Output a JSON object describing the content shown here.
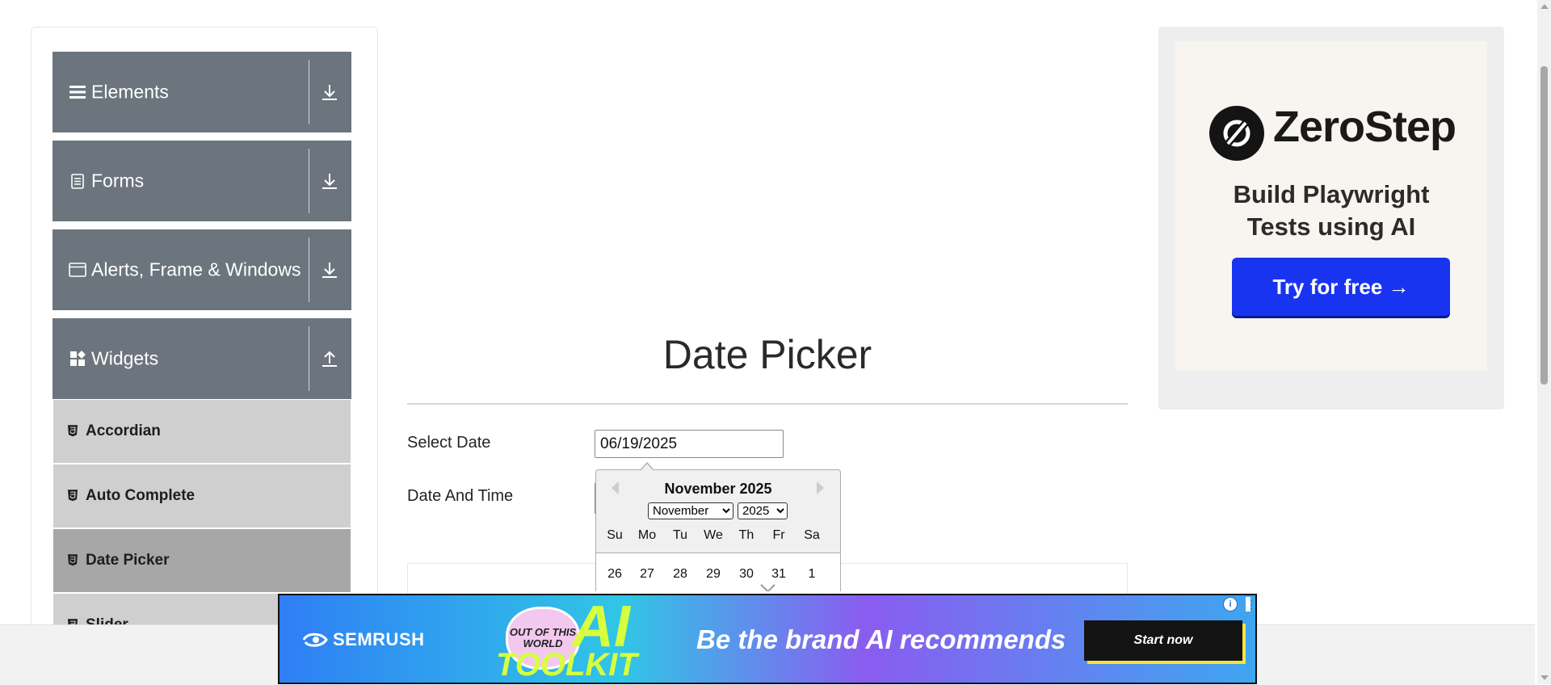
{
  "sidebar": {
    "groups": [
      {
        "label": "Elements",
        "icon": "bars-icon",
        "arrow": "download-arrow-icon"
      },
      {
        "label": "Forms",
        "icon": "document-icon",
        "arrow": "download-arrow-icon"
      },
      {
        "label": "Alerts, Frame & Windows",
        "icon": "window-icon",
        "arrow": "download-arrow-icon"
      },
      {
        "label": "Widgets",
        "icon": "widgets-icon",
        "arrow": "upload-arrow-icon"
      }
    ],
    "items": [
      {
        "label": "Accordian",
        "active": false
      },
      {
        "label": "Auto Complete",
        "active": false
      },
      {
        "label": "Date Picker",
        "active": true
      },
      {
        "label": "Slider",
        "active": false
      }
    ]
  },
  "main": {
    "title": "Date Picker",
    "select_date_label": "Select Date",
    "select_date_value": "06/19/2025",
    "date_time_label": "Date And Time"
  },
  "datepicker": {
    "month_title": "November 2025",
    "month_selected": "November",
    "year_selected": "2025",
    "weekdays": [
      "Su",
      "Mo",
      "Tu",
      "We",
      "Th",
      "Fr",
      "Sa"
    ],
    "first_week": [
      "26",
      "27",
      "28",
      "29",
      "30",
      "31",
      "1"
    ]
  },
  "ad_right": {
    "brand": "ZeroStep",
    "headline_line1": "Build Playwright",
    "headline_line2": "Tests using AI",
    "cta": "Try for free →"
  },
  "ad_bottom": {
    "brand": "SEMRUSH",
    "badge": "OUT OF THIS WORLD",
    "ai_word": "AI",
    "toolkit": "TOOLKIT",
    "headline": "Be the brand AI recommends",
    "cta": "Start now"
  },
  "colors": {
    "sidebar_group_bg": "#6c757d",
    "sidebar_item_bg": "#cfcfcf",
    "sidebar_item_active_bg": "#a7a7a7",
    "zerostep_button": "#1934f0"
  }
}
